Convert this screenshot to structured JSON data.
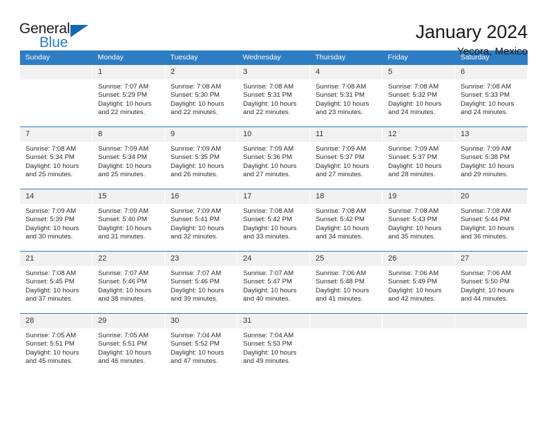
{
  "brand": {
    "name_part1": "General",
    "name_part2": "Blue",
    "triangle_color": "#1268b3",
    "blue_color": "#2b7cc4"
  },
  "header": {
    "title": "January 2024",
    "subtitle": "Yecora, Mexico"
  },
  "theme": {
    "header_bg": "#2e7dc2",
    "header_text": "#ffffff",
    "daynum_bg": "#f1f1f1",
    "separator": "#2e7dc2"
  },
  "weekday_headers": [
    "Sunday",
    "Monday",
    "Tuesday",
    "Wednesday",
    "Thursday",
    "Friday",
    "Saturday"
  ],
  "weeks": [
    [
      {
        "day": "",
        "empty": true,
        "sunrise": "",
        "sunset": "",
        "daylight1": "",
        "daylight2": ""
      },
      {
        "day": "1",
        "sunrise": "Sunrise: 7:07 AM",
        "sunset": "Sunset: 5:29 PM",
        "daylight1": "Daylight: 10 hours",
        "daylight2": "and 22 minutes."
      },
      {
        "day": "2",
        "sunrise": "Sunrise: 7:08 AM",
        "sunset": "Sunset: 5:30 PM",
        "daylight1": "Daylight: 10 hours",
        "daylight2": "and 22 minutes."
      },
      {
        "day": "3",
        "sunrise": "Sunrise: 7:08 AM",
        "sunset": "Sunset: 5:31 PM",
        "daylight1": "Daylight: 10 hours",
        "daylight2": "and 22 minutes."
      },
      {
        "day": "4",
        "sunrise": "Sunrise: 7:08 AM",
        "sunset": "Sunset: 5:31 PM",
        "daylight1": "Daylight: 10 hours",
        "daylight2": "and 23 minutes."
      },
      {
        "day": "5",
        "sunrise": "Sunrise: 7:08 AM",
        "sunset": "Sunset: 5:32 PM",
        "daylight1": "Daylight: 10 hours",
        "daylight2": "and 24 minutes."
      },
      {
        "day": "6",
        "sunrise": "Sunrise: 7:08 AM",
        "sunset": "Sunset: 5:33 PM",
        "daylight1": "Daylight: 10 hours",
        "daylight2": "and 24 minutes."
      }
    ],
    [
      {
        "day": "7",
        "sunrise": "Sunrise: 7:08 AM",
        "sunset": "Sunset: 5:34 PM",
        "daylight1": "Daylight: 10 hours",
        "daylight2": "and 25 minutes."
      },
      {
        "day": "8",
        "sunrise": "Sunrise: 7:09 AM",
        "sunset": "Sunset: 5:34 PM",
        "daylight1": "Daylight: 10 hours",
        "daylight2": "and 25 minutes."
      },
      {
        "day": "9",
        "sunrise": "Sunrise: 7:09 AM",
        "sunset": "Sunset: 5:35 PM",
        "daylight1": "Daylight: 10 hours",
        "daylight2": "and 26 minutes."
      },
      {
        "day": "10",
        "sunrise": "Sunrise: 7:09 AM",
        "sunset": "Sunset: 5:36 PM",
        "daylight1": "Daylight: 10 hours",
        "daylight2": "and 27 minutes."
      },
      {
        "day": "11",
        "sunrise": "Sunrise: 7:09 AM",
        "sunset": "Sunset: 5:37 PM",
        "daylight1": "Daylight: 10 hours",
        "daylight2": "and 27 minutes."
      },
      {
        "day": "12",
        "sunrise": "Sunrise: 7:09 AM",
        "sunset": "Sunset: 5:37 PM",
        "daylight1": "Daylight: 10 hours",
        "daylight2": "and 28 minutes."
      },
      {
        "day": "13",
        "sunrise": "Sunrise: 7:09 AM",
        "sunset": "Sunset: 5:38 PM",
        "daylight1": "Daylight: 10 hours",
        "daylight2": "and 29 minutes."
      }
    ],
    [
      {
        "day": "14",
        "sunrise": "Sunrise: 7:09 AM",
        "sunset": "Sunset: 5:39 PM",
        "daylight1": "Daylight: 10 hours",
        "daylight2": "and 30 minutes."
      },
      {
        "day": "15",
        "sunrise": "Sunrise: 7:09 AM",
        "sunset": "Sunset: 5:40 PM",
        "daylight1": "Daylight: 10 hours",
        "daylight2": "and 31 minutes."
      },
      {
        "day": "16",
        "sunrise": "Sunrise: 7:09 AM",
        "sunset": "Sunset: 5:41 PM",
        "daylight1": "Daylight: 10 hours",
        "daylight2": "and 32 minutes."
      },
      {
        "day": "17",
        "sunrise": "Sunrise: 7:08 AM",
        "sunset": "Sunset: 5:42 PM",
        "daylight1": "Daylight: 10 hours",
        "daylight2": "and 33 minutes."
      },
      {
        "day": "18",
        "sunrise": "Sunrise: 7:08 AM",
        "sunset": "Sunset: 5:42 PM",
        "daylight1": "Daylight: 10 hours",
        "daylight2": "and 34 minutes."
      },
      {
        "day": "19",
        "sunrise": "Sunrise: 7:08 AM",
        "sunset": "Sunset: 5:43 PM",
        "daylight1": "Daylight: 10 hours",
        "daylight2": "and 35 minutes."
      },
      {
        "day": "20",
        "sunrise": "Sunrise: 7:08 AM",
        "sunset": "Sunset: 5:44 PM",
        "daylight1": "Daylight: 10 hours",
        "daylight2": "and 36 minutes."
      }
    ],
    [
      {
        "day": "21",
        "sunrise": "Sunrise: 7:08 AM",
        "sunset": "Sunset: 5:45 PM",
        "daylight1": "Daylight: 10 hours",
        "daylight2": "and 37 minutes."
      },
      {
        "day": "22",
        "sunrise": "Sunrise: 7:07 AM",
        "sunset": "Sunset: 5:46 PM",
        "daylight1": "Daylight: 10 hours",
        "daylight2": "and 38 minutes."
      },
      {
        "day": "23",
        "sunrise": "Sunrise: 7:07 AM",
        "sunset": "Sunset: 5:46 PM",
        "daylight1": "Daylight: 10 hours",
        "daylight2": "and 39 minutes."
      },
      {
        "day": "24",
        "sunrise": "Sunrise: 7:07 AM",
        "sunset": "Sunset: 5:47 PM",
        "daylight1": "Daylight: 10 hours",
        "daylight2": "and 40 minutes."
      },
      {
        "day": "25",
        "sunrise": "Sunrise: 7:06 AM",
        "sunset": "Sunset: 5:48 PM",
        "daylight1": "Daylight: 10 hours",
        "daylight2": "and 41 minutes."
      },
      {
        "day": "26",
        "sunrise": "Sunrise: 7:06 AM",
        "sunset": "Sunset: 5:49 PM",
        "daylight1": "Daylight: 10 hours",
        "daylight2": "and 42 minutes."
      },
      {
        "day": "27",
        "sunrise": "Sunrise: 7:06 AM",
        "sunset": "Sunset: 5:50 PM",
        "daylight1": "Daylight: 10 hours",
        "daylight2": "and 44 minutes."
      }
    ],
    [
      {
        "day": "28",
        "sunrise": "Sunrise: 7:05 AM",
        "sunset": "Sunset: 5:51 PM",
        "daylight1": "Daylight: 10 hours",
        "daylight2": "and 45 minutes."
      },
      {
        "day": "29",
        "sunrise": "Sunrise: 7:05 AM",
        "sunset": "Sunset: 5:51 PM",
        "daylight1": "Daylight: 10 hours",
        "daylight2": "and 46 minutes."
      },
      {
        "day": "30",
        "sunrise": "Sunrise: 7:04 AM",
        "sunset": "Sunset: 5:52 PM",
        "daylight1": "Daylight: 10 hours",
        "daylight2": "and 47 minutes."
      },
      {
        "day": "31",
        "sunrise": "Sunrise: 7:04 AM",
        "sunset": "Sunset: 5:53 PM",
        "daylight1": "Daylight: 10 hours",
        "daylight2": "and 49 minutes."
      },
      {
        "day": "",
        "empty": true,
        "sunrise": "",
        "sunset": "",
        "daylight1": "",
        "daylight2": ""
      },
      {
        "day": "",
        "empty": true,
        "sunrise": "",
        "sunset": "",
        "daylight1": "",
        "daylight2": ""
      },
      {
        "day": "",
        "empty": true,
        "sunrise": "",
        "sunset": "",
        "daylight1": "",
        "daylight2": ""
      }
    ]
  ]
}
